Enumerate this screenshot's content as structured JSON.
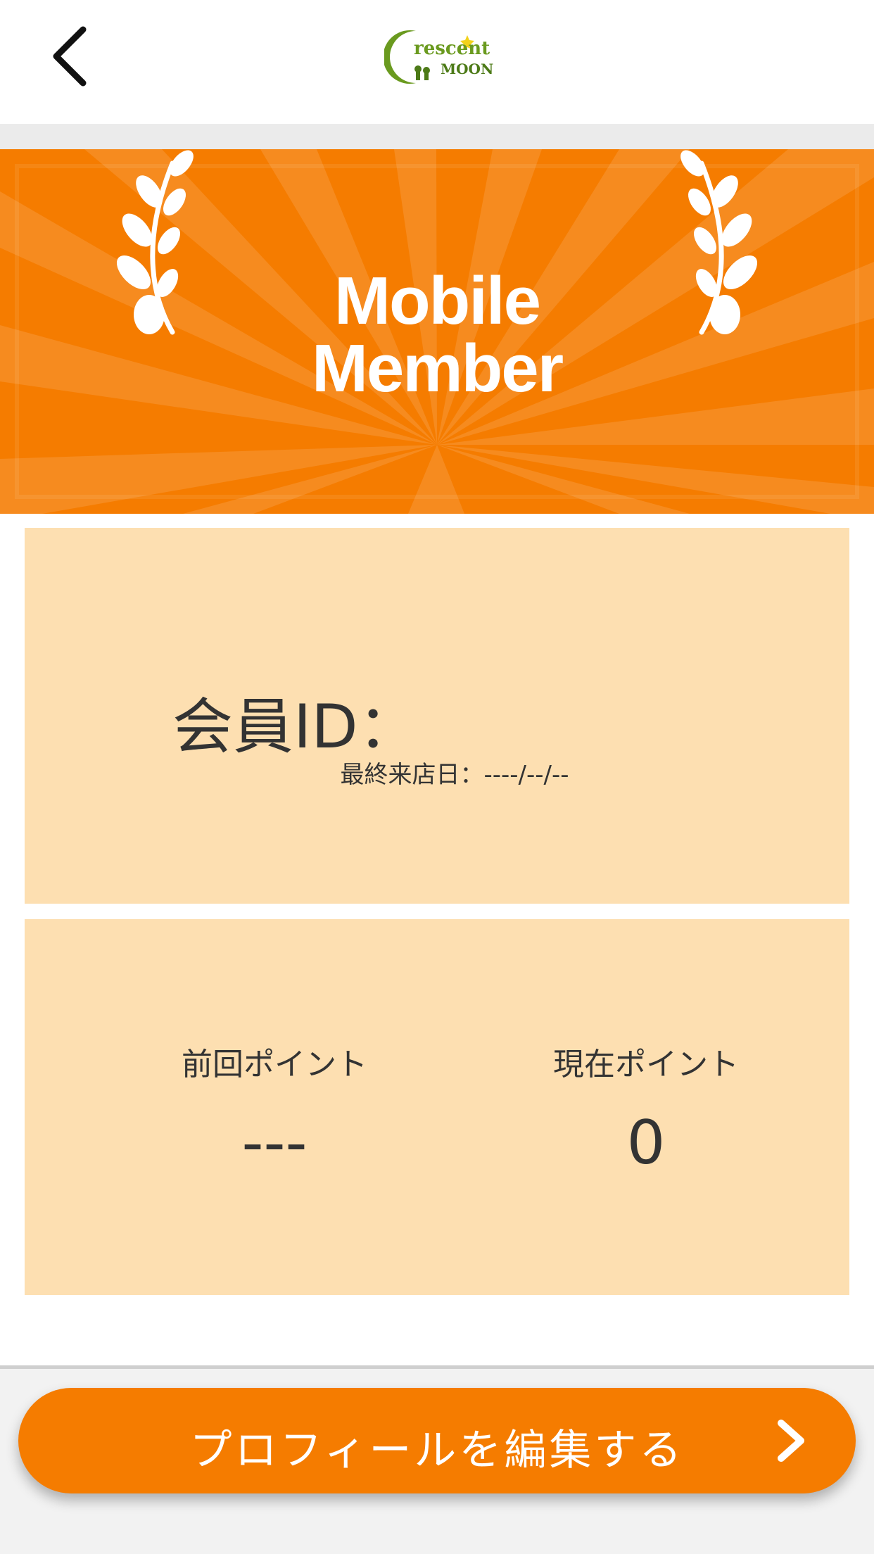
{
  "header": {
    "back_icon": "chevron-left-icon",
    "logo": {
      "text_top": "rescent",
      "text_bottom": "MOON",
      "initial": "C"
    }
  },
  "banner": {
    "title_line1": "Mobile",
    "title_line2": "Member",
    "background_color": "#f57c00"
  },
  "member_card": {
    "member_id_label": "会員ID：",
    "last_visit_label": "最終来店日：",
    "last_visit_value": "----/--/--"
  },
  "points_card": {
    "previous_points_label": "前回ポイント",
    "previous_points_value": "---",
    "current_points_label": "現在ポイント",
    "current_points_value": "0"
  },
  "edit_profile_button": {
    "label": "プロフィールを編集する",
    "icon": "chevron-right-icon",
    "color": "#f57c00"
  },
  "colors": {
    "accent": "#f57c00",
    "card_background": "#fddfb1",
    "text": "#333333"
  }
}
